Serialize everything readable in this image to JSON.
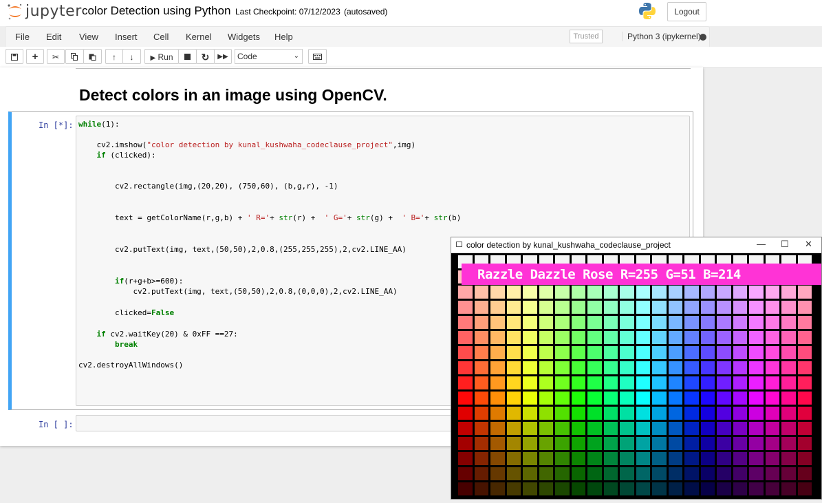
{
  "header": {
    "logo_text": "jupyter",
    "notebook_title": "color Detection using Python",
    "checkpoint": "Last Checkpoint: 07/12/2023",
    "autosaved": "(autosaved)",
    "logout_label": "Logout"
  },
  "menu": {
    "items": [
      "File",
      "Edit",
      "View",
      "Insert",
      "Cell",
      "Kernel",
      "Widgets",
      "Help"
    ],
    "trusted": "Trusted",
    "kernel": "Python 3 (ipykernel)"
  },
  "toolbar": {
    "run_label": "Run",
    "cell_type": "Code"
  },
  "notebook": {
    "heading": "Detect colors in an image using OpenCV.",
    "cell1_prompt": "In [*]:",
    "cell2_prompt": "In [ ]:"
  },
  "code_lines": [
    "while(1):",
    "",
    "    cv2.imshow(\"color detection by kunal_kushwaha_codeclause_project\",img)",
    "    if (clicked):",
    "",
    "",
    "        cv2.rectangle(img,(20,20), (750,60), (b,g,r), -1)",
    "",
    "",
    "        text = getColorName(r,g,b) + ' R='+ str(r) +  ' G='+ str(g) +  ' B='+ str(b)",
    "",
    "",
    "        cv2.putText(img, text,(50,50),2,0.8,(255,255,255),2,cv2.LINE_AA)",
    "",
    "",
    "        if(r+g+b>=600):",
    "            cv2.putText(img, text,(50,50),2,0.8,(0,0,0),2,cv2.LINE_AA)",
    "",
    "        clicked=False",
    "",
    "    if cv2.waitKey(20) & 0xFF ==27:",
    "        break",
    "",
    "cv2.destroyAllWindows()"
  ],
  "cv_window": {
    "title": "color detection by kunal_kushwaha_codeclause_project",
    "banner_text": "Razzle Dazzle Rose R=255 G=51 B=214",
    "banner_color": "#ff33d6"
  },
  "colors": {
    "accent_blue": "#42a5f5",
    "prompt_blue": "#303f9f",
    "keyword_green": "#008000",
    "string_red": "#ba2121",
    "operator_purple": "#aa22ff"
  }
}
